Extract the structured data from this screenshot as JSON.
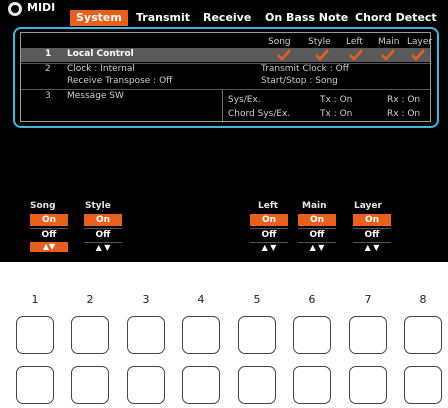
{
  "app": {
    "title": "MIDI",
    "icon": "midi-circle-icon"
  },
  "tabs": [
    "System",
    "Transmit",
    "Receive",
    "On Bass Note",
    "Chord Detect"
  ],
  "active_tab": "System",
  "column_headers": [
    "Song",
    "Style",
    "Left",
    "Main",
    "Layer"
  ],
  "rows": {
    "local_control": {
      "num": "1",
      "label": "Local Control"
    },
    "clock": {
      "num": "2",
      "label": "Clock : Internal",
      "transmit_clock": "Transmit Clock : Off"
    },
    "receive_transpose": {
      "label": "Receive Transpose : Off",
      "start_stop": "Start/Stop : Song"
    },
    "message_sw": {
      "num": "3",
      "label": "Message SW"
    },
    "sysex": {
      "label": "Sys/Ex.",
      "tx": "Tx : On",
      "rx": "Rx : On"
    },
    "chord_sysex": {
      "label": "Chord Sys/Ex.",
      "tx": "Tx : On",
      "rx": "Rx : On"
    }
  },
  "controls": [
    {
      "label": "Song",
      "on": "On",
      "off": "Off",
      "arrows": "▲▼"
    },
    {
      "label": "Style",
      "on": "On",
      "off": "Off",
      "arrows": "▲ ▼"
    },
    {
      "label": "Left",
      "on": "On",
      "off": "Off",
      "arrows": "▲ ▼"
    },
    {
      "label": "Main",
      "on": "On",
      "off": "Off",
      "arrows": "▲ ▼"
    },
    {
      "label": "Layer",
      "on": "On",
      "off": "Off",
      "arrows": "▲ ▼"
    }
  ],
  "button_numbers": [
    "1",
    "2",
    "3",
    "4",
    "5",
    "6",
    "7",
    "8"
  ],
  "colors": {
    "accent": "#e8601c",
    "highlight_border": "#3fb8dc",
    "screen_bg": "#000000"
  }
}
